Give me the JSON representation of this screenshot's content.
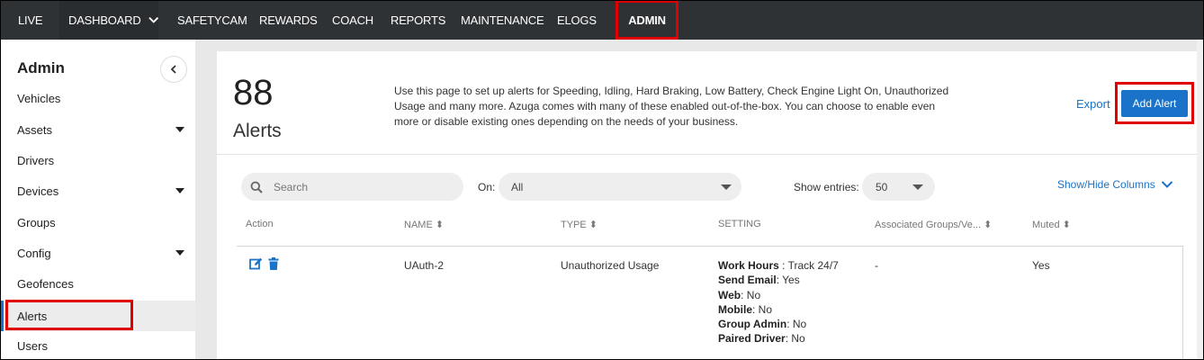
{
  "topnav": {
    "items": [
      {
        "label": "LIVE"
      },
      {
        "label": "DASHBOARD"
      },
      {
        "label": "SAFETYCAM"
      },
      {
        "label": "REWARDS"
      },
      {
        "label": "COACH"
      },
      {
        "label": "REPORTS"
      },
      {
        "label": "MAINTENANCE"
      },
      {
        "label": "ELOGS"
      },
      {
        "label": "ADMIN"
      }
    ],
    "active": "ADMIN"
  },
  "sidebar": {
    "title": "Admin",
    "items": [
      {
        "label": "Vehicles",
        "expandable": false
      },
      {
        "label": "Assets",
        "expandable": true
      },
      {
        "label": "Drivers",
        "expandable": false
      },
      {
        "label": "Devices",
        "expandable": true
      },
      {
        "label": "Groups",
        "expandable": false
      },
      {
        "label": "Config",
        "expandable": true
      },
      {
        "label": "Geofences",
        "expandable": false
      },
      {
        "label": "Alerts",
        "expandable": false,
        "active": true
      },
      {
        "label": "Users",
        "expandable": false
      }
    ]
  },
  "header": {
    "count": "88",
    "count_label": "Alerts",
    "description": "Use this page to set up alerts for Speeding, Idling, Hard Braking, Low Battery, Check Engine Light On, Unauthorized Usage and many more. Azuga comes with many of these enabled out-of-the-box. You can choose to enable even more or disable existing ones depending on the needs of your business.",
    "export_label": "Export",
    "add_alert_label": "Add Alert"
  },
  "filters": {
    "search_placeholder": "Search",
    "on_label": "On:",
    "on_value": "All",
    "entries_label": "Show entries:",
    "entries_value": "50",
    "show_hide_label": "Show/Hide Columns"
  },
  "table": {
    "columns": [
      "Action",
      "NAME ⬍",
      "TYPE ⬍",
      "SETTING",
      "Associated Groups/Ve... ⬍",
      "Muted ⬍"
    ],
    "rows": [
      {
        "name": "UAuth-2",
        "type": "Unauthorized Usage",
        "setting": [
          {
            "key": "Work Hours",
            "sep": " : ",
            "value": "Track 24/7"
          },
          {
            "key": "Send Email",
            "sep": ": ",
            "value": "Yes"
          },
          {
            "key": "Web",
            "sep": ": ",
            "value": "No"
          },
          {
            "key": "Mobile",
            "sep": ": ",
            "value": "No"
          },
          {
            "key": "Group Admin",
            "sep": ": ",
            "value": "No"
          },
          {
            "key": "Paired Driver",
            "sep": ": ",
            "value": "No"
          }
        ],
        "groups": "-",
        "muted": "Yes"
      }
    ]
  },
  "colors": {
    "nav_bg": "#2f3235",
    "accent": "#1a73c8",
    "highlight": "#e00000"
  }
}
